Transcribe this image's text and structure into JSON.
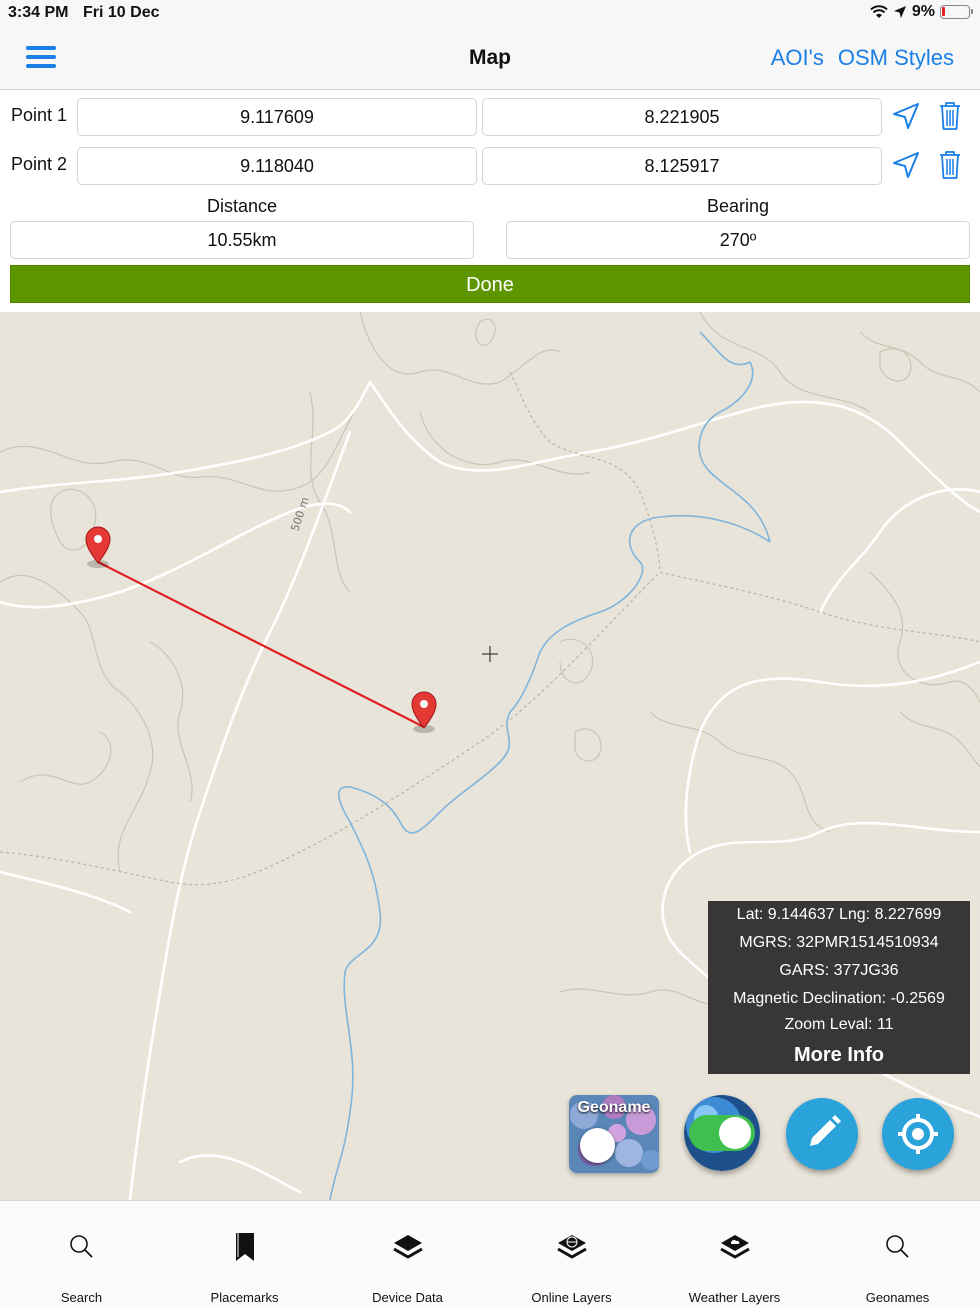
{
  "status_bar": {
    "time": "3:34 PM",
    "date": "Fri 10 Dec",
    "battery": "9%",
    "icons": [
      "wifi-icon",
      "location-arrow-icon",
      "battery-low-icon"
    ]
  },
  "nav": {
    "title": "Map",
    "aois_label": "AOI's",
    "osm_styles_label": "OSM Styles",
    "accent_color": "#1a7fe6"
  },
  "form": {
    "points": [
      {
        "label": "Point 1",
        "lat": "9.117609",
        "lng": "8.221905"
      },
      {
        "label": "Point 2",
        "lat": "9.118040",
        "lng": "8.125917"
      }
    ],
    "distance_label": "Distance",
    "distance_value": "10.55km",
    "bearing_label": "Bearing",
    "bearing_value": "270º",
    "done_label": "Done",
    "done_color": "#5e9600"
  },
  "map": {
    "contour_label": "500 m",
    "info": {
      "latlng": "Lat: 9.144637 Lng: 8.227699",
      "mgrs": "MGRS: 32PMR1514510934",
      "gars": "GARS: 377JG36",
      "declination": "Magnetic Declination: -0.2569",
      "zoom": "Zoom Leval: 11",
      "more_info": "More Info"
    },
    "geoname_label": "Geoname"
  },
  "tabs": [
    {
      "label": "Search",
      "icon": "search-icon"
    },
    {
      "label": "Placemarks",
      "icon": "bookmark-icon"
    },
    {
      "label": "Device Data",
      "icon": "layers-icon"
    },
    {
      "label": "Online Layers",
      "icon": "globe-layers-icon"
    },
    {
      "label": "Weather Layers",
      "icon": "weather-layers-icon"
    },
    {
      "label": "Geonames",
      "icon": "search-icon"
    }
  ]
}
